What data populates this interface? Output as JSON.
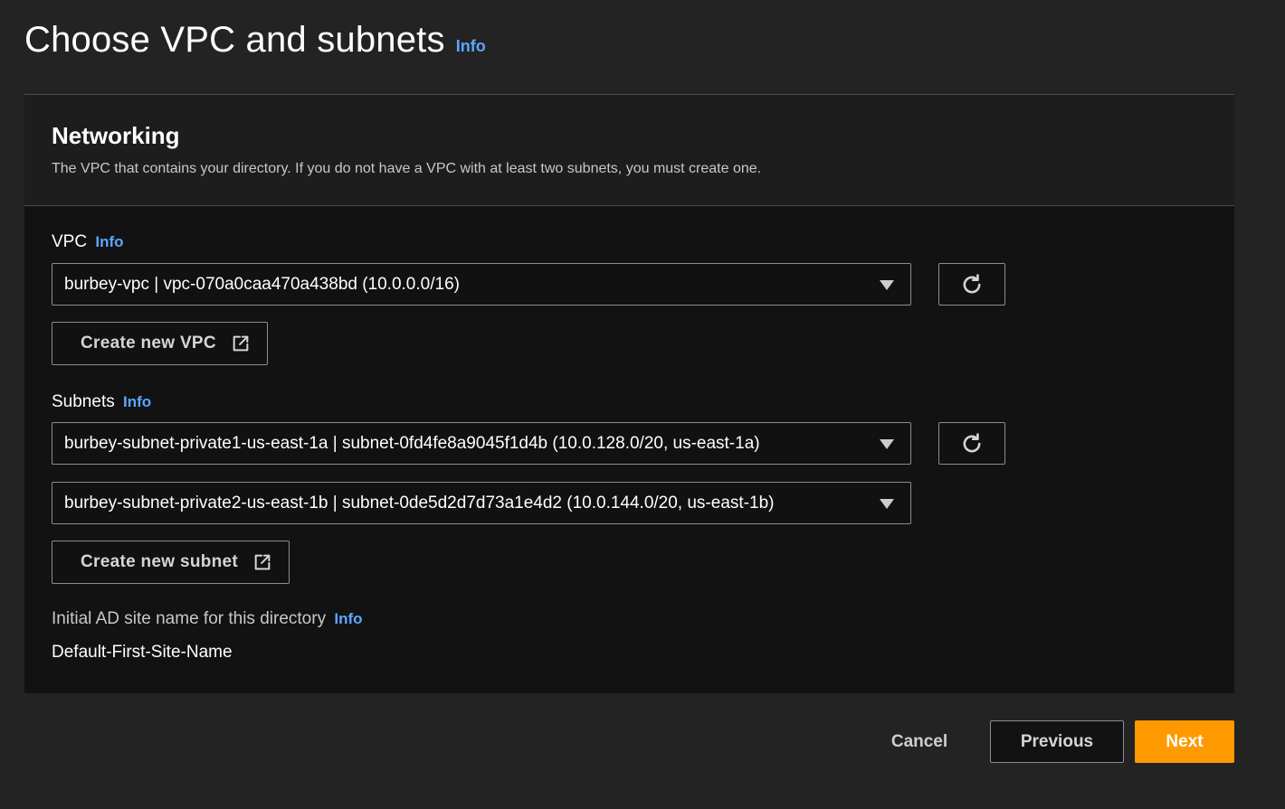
{
  "header": {
    "title": "Choose VPC and subnets",
    "info": "Info"
  },
  "networking": {
    "title": "Networking",
    "description": "The VPC that contains your directory. If you do not have a VPC with at least two subnets, you must create one."
  },
  "vpc": {
    "label": "VPC",
    "info": "Info",
    "selected": "burbey-vpc | vpc-070a0caa470a438bd (10.0.0.0/16)",
    "create_button": "Create new VPC"
  },
  "subnets": {
    "label": "Subnets",
    "info": "Info",
    "subnet1": "burbey-subnet-private1-us-east-1a | subnet-0fd4fe8a9045f1d4b (10.0.128.0/20, us-east-1a)",
    "subnet2": "burbey-subnet-private2-us-east-1b | subnet-0de5d2d7d73a1e4d2 (10.0.144.0/20, us-east-1b)",
    "create_button": "Create new subnet"
  },
  "ad_site": {
    "label": "Initial AD site name for this directory",
    "info": "Info",
    "value": "Default-First-Site-Name"
  },
  "footer": {
    "cancel": "Cancel",
    "previous": "Previous",
    "next": "Next"
  },
  "icons": {
    "refresh": "refresh-icon",
    "external": "external-link-icon",
    "caret": "caret-down-icon"
  },
  "colors": {
    "primary_button": "#ff9900",
    "info_link": "#5ba7ff",
    "background": "#232323",
    "panel": "#121212"
  }
}
